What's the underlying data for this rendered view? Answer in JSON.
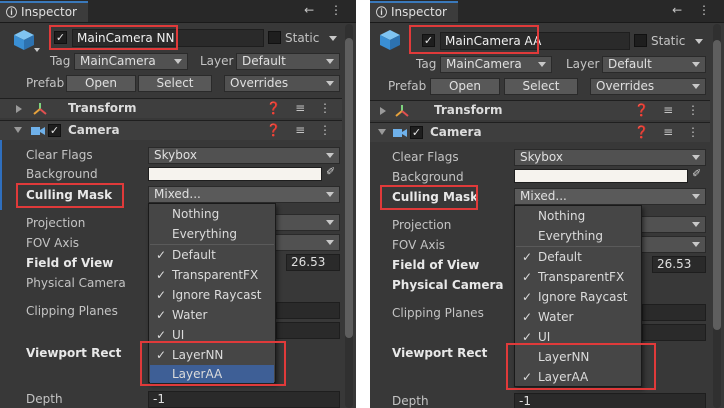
{
  "tab_title": "Inspector",
  "tab_icons": "← ⋮",
  "header_icons": "❓ ≡ ⋮",
  "static_label": "Static",
  "tag_label": "Tag",
  "tag_value": "MainCamera",
  "layer_label": "Layer",
  "layer_value": "Default",
  "prefab_label": "Prefab",
  "open_label": "Open",
  "select_label": "Select",
  "overrides_label": "Overrides",
  "transform_label": "Transform",
  "camera_label": "Camera",
  "checkmark": "✓",
  "fields": {
    "clear_flags": "Clear Flags",
    "clear_flags_value": "Skybox",
    "background": "Background",
    "culling_mask": "Culling Mask",
    "culling_mask_value": "Mixed...",
    "projection": "Projection",
    "fov_axis": "FOV Axis",
    "field_of_view": "Field of View",
    "fov_value": "26.53",
    "physical_camera": "Physical Camera",
    "clipping_planes": "Clipping Planes",
    "viewport_rect": "Viewport Rect",
    "depth": "Depth",
    "depth_value": "-1"
  },
  "panels": [
    {
      "object_name": "MainCamera NN",
      "popup_items": [
        {
          "label": "Nothing",
          "checked": "",
          "selected": false
        },
        {
          "label": "Everything",
          "checked": "",
          "selected": false
        },
        {
          "label": "Default",
          "checked": "✓",
          "selected": false
        },
        {
          "label": "TransparentFX",
          "checked": "✓",
          "selected": false
        },
        {
          "label": "Ignore Raycast",
          "checked": "✓",
          "selected": false
        },
        {
          "label": "Water",
          "checked": "✓",
          "selected": false
        },
        {
          "label": "UI",
          "checked": "✓",
          "selected": false
        },
        {
          "label": "LayerNN",
          "checked": "✓",
          "selected": false
        },
        {
          "label": "LayerAA",
          "checked": "",
          "selected": true
        }
      ]
    },
    {
      "object_name": "MainCamera AA",
      "popup_items": [
        {
          "label": "Nothing",
          "checked": "",
          "selected": false
        },
        {
          "label": "Everything",
          "checked": "",
          "selected": false
        },
        {
          "label": "Default",
          "checked": "✓",
          "selected": false
        },
        {
          "label": "TransparentFX",
          "checked": "✓",
          "selected": false
        },
        {
          "label": "Ignore Raycast",
          "checked": "✓",
          "selected": false
        },
        {
          "label": "Water",
          "checked": "✓",
          "selected": false
        },
        {
          "label": "UI",
          "checked": "✓",
          "selected": false
        },
        {
          "label": "LayerNN",
          "checked": "",
          "selected": false
        },
        {
          "label": "LayerAA",
          "checked": "✓",
          "selected": false
        }
      ]
    }
  ],
  "colors": {
    "highlight_box": "#e03a3a",
    "selected_item": "#3e5f96",
    "panel_bg": "#383838"
  }
}
